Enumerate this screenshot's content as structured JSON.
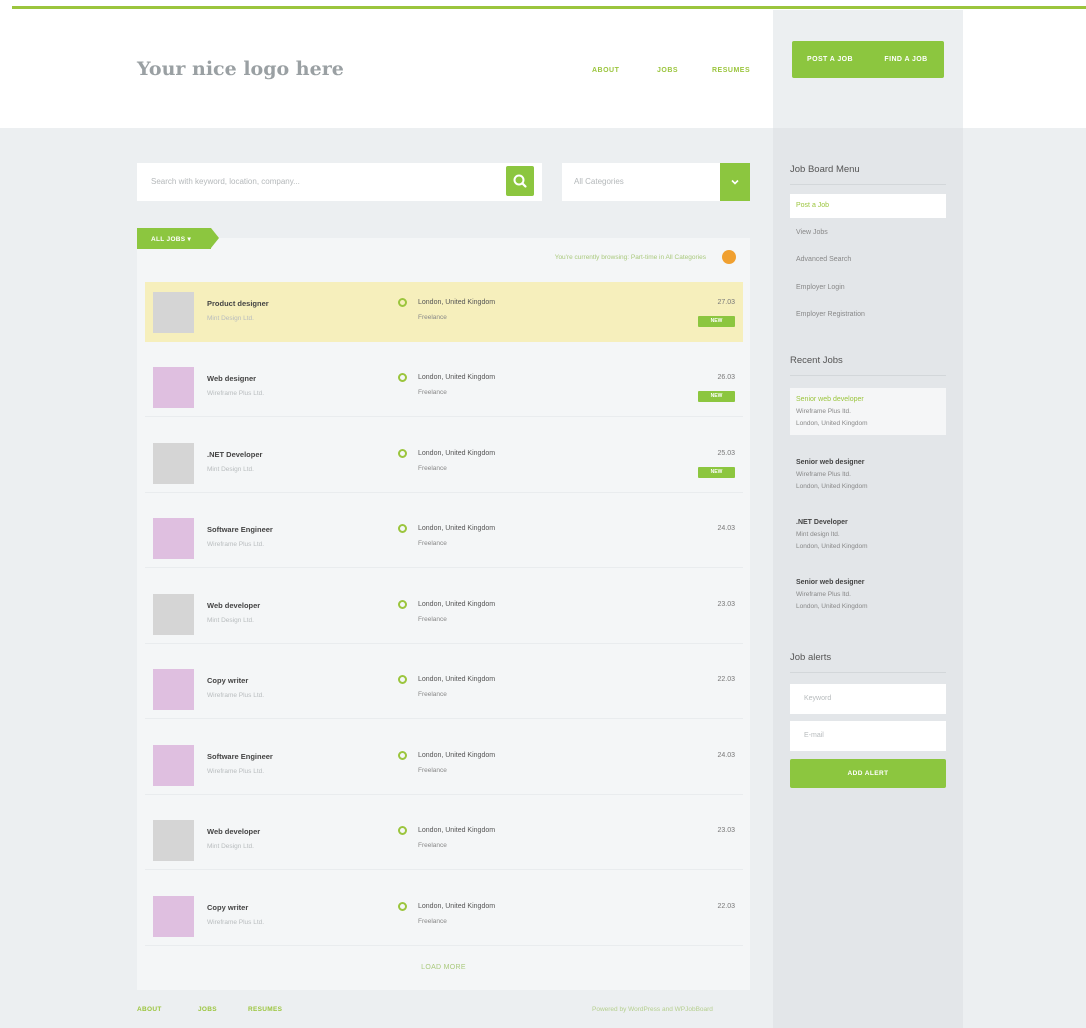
{
  "header": {
    "logo": "Your nice logo here",
    "nav": [
      "ABOUT",
      "JOBS",
      "RESUMES"
    ],
    "post_job": "POST A JOB",
    "find_job": "FIND A JOB"
  },
  "search": {
    "placeholder": "Search with keyword, location, company...",
    "category": "All Categories"
  },
  "listing": {
    "tab": "ALL JOBS",
    "filter_text": "You're currently browsing: Part-time in All Categories",
    "load_more": "LOAD MORE"
  },
  "jobs": [
    {
      "title": "Product designer",
      "company": "Mint Design Ltd.",
      "location": "London, United Kingdom",
      "type": "Freelance",
      "date": "27.03",
      "badge": "NEW",
      "featured": true
    },
    {
      "title": "Web designer",
      "company": "Wireframe Plus Ltd.",
      "location": "London, United Kingdom",
      "type": "Freelance",
      "date": "26.03",
      "badge": "NEW",
      "featured": false
    },
    {
      "title": ".NET Developer",
      "company": "Mint Design Ltd.",
      "location": "London, United Kingdom",
      "type": "Freelance",
      "date": "25.03",
      "badge": "NEW",
      "featured": false
    },
    {
      "title": "Software Engineer",
      "company": "Wireframe Plus Ltd.",
      "location": "London, United Kingdom",
      "type": "Freelance",
      "date": "24.03",
      "badge": "",
      "featured": false
    },
    {
      "title": "Web developer",
      "company": "Mint Design Ltd.",
      "location": "London, United Kingdom",
      "type": "Freelance",
      "date": "23.03",
      "badge": "",
      "featured": false
    },
    {
      "title": "Copy writer",
      "company": "Wireframe Plus Ltd.",
      "location": "London, United Kingdom",
      "type": "Freelance",
      "date": "22.03",
      "badge": "",
      "featured": false
    },
    {
      "title": "Software Engineer",
      "company": "Wireframe Plus Ltd.",
      "location": "London, United Kingdom",
      "type": "Freelance",
      "date": "24.03",
      "badge": "",
      "featured": false
    },
    {
      "title": "Web developer",
      "company": "Mint Design Ltd.",
      "location": "London, United Kingdom",
      "type": "Freelance",
      "date": "23.03",
      "badge": "",
      "featured": false
    },
    {
      "title": "Copy writer",
      "company": "Wireframe Plus Ltd.",
      "location": "London, United Kingdom",
      "type": "Freelance",
      "date": "22.03",
      "badge": "",
      "featured": false
    }
  ],
  "sidebar": {
    "menu_title": "Job Board Menu",
    "menu": [
      "Post a Job",
      "View Jobs",
      "Advanced Search",
      "Employer Login",
      "Employer Registration"
    ],
    "recent_title": "Recent Jobs",
    "recent": [
      {
        "title": "Senior web developer",
        "company": "Wireframe Plus ltd.",
        "location": "London, United Kingdom"
      },
      {
        "title": "Senior web designer",
        "company": "Wireframe Plus ltd.",
        "location": "London, United Kingdom"
      },
      {
        "title": ".NET Developer",
        "company": "Mint design ltd.",
        "location": "London, United Kingdom"
      },
      {
        "title": "Senior web designer",
        "company": "Wireframe Plus ltd.",
        "location": "London, United Kingdom"
      }
    ],
    "alerts_title": "Job alerts",
    "keyword_placeholder": "Keyword",
    "email_placeholder": "E-mail",
    "alert_button": "ADD ALERT"
  },
  "footer": {
    "links": [
      "ABOUT",
      "JOBS",
      "RESUMES"
    ],
    "powered": "Powered by WordPress and WPJobBoard"
  },
  "colors": {
    "accent": "#8cc63f",
    "featured": "#f6efbc",
    "rss": "#f0a030"
  },
  "icons": [
    "search-icon",
    "chevron-down-icon",
    "rss-icon",
    "location-pin-icon"
  ]
}
